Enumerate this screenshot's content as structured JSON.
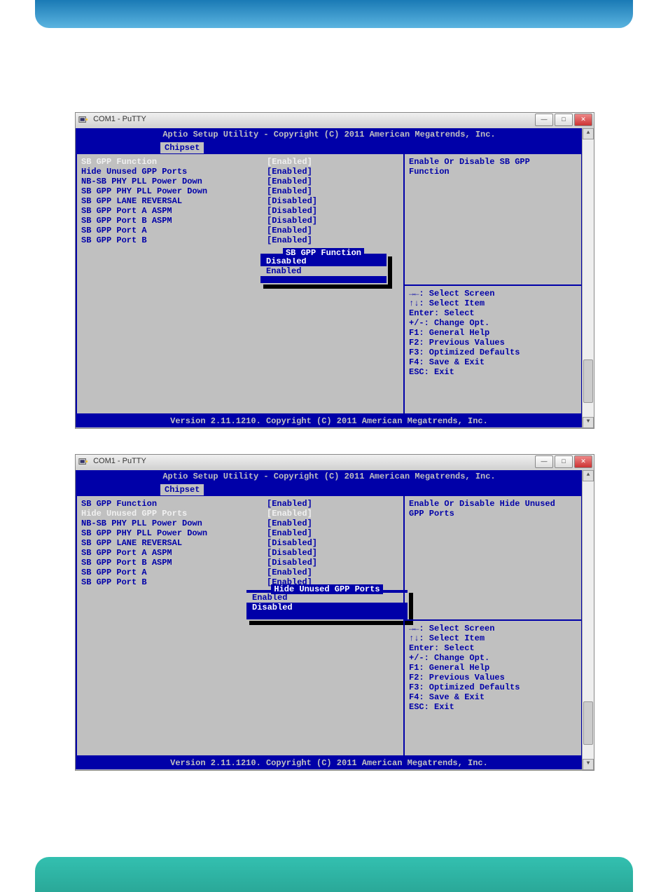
{
  "window_title": "COM1 - PuTTY",
  "bios_header": "Aptio Setup Utility - Copyright (C) 2011 American Megatrends, Inc.",
  "bios_tab": "Chipset",
  "bios_footer": "Version 2.11.1210. Copyright (C) 2011 American Megatrends, Inc.",
  "settings": [
    {
      "label": "SB GPP Function",
      "value": "[Enabled]"
    },
    {
      "label": "Hide Unused GPP Ports",
      "value": "[Enabled]"
    },
    {
      "label": "NB-SB PHY PLL Power Down",
      "value": "[Enabled]"
    },
    {
      "label": "SB GPP PHY PLL Power Down",
      "value": "[Enabled]"
    },
    {
      "label": "SB GPP LANE REVERSAL",
      "value": "[Disabled]"
    },
    {
      "label": "SB GPP Port A ASPM",
      "value": "[Disabled]"
    },
    {
      "label": "SB GPP Port B ASPM",
      "value": "[Disabled]"
    },
    {
      "label": "SB GPP Port A",
      "value": "[Enabled]"
    },
    {
      "label": "SB GPP Port B",
      "value": "[Enabled]"
    }
  ],
  "help1_line1": "Enable Or Disable SB GPP",
  "help1_line2": "Function",
  "help2_line1": "Enable Or Disable Hide Unused",
  "help2_line2": "GPP Ports",
  "nav": [
    "→←: Select Screen",
    "↑↓: Select Item",
    "Enter: Select",
    "+/-: Change Opt.",
    "F1: General Help",
    "F2: Previous Values",
    "F3: Optimized Defaults",
    "F4: Save & Exit",
    "ESC: Exit"
  ],
  "popup1": {
    "title": "SB GPP Function",
    "items": [
      "Disabled",
      "Enabled"
    ],
    "selected": 1
  },
  "popup2": {
    "title": "Hide Unused GPP Ports",
    "items": [
      "Enabled",
      "Disabled"
    ],
    "selected": 0
  }
}
